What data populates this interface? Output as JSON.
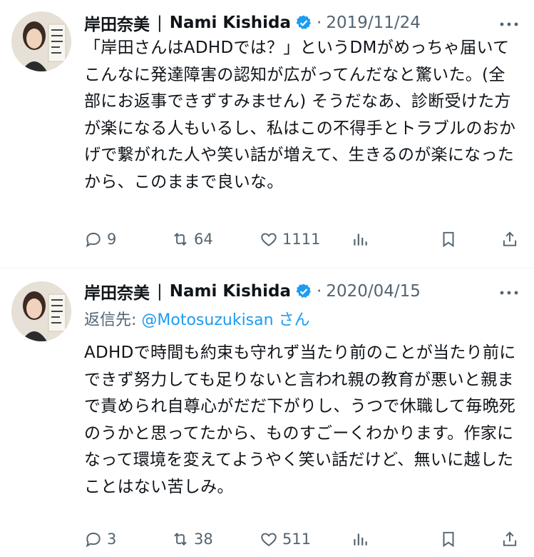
{
  "tweets": [
    {
      "display_name": "岸田奈美",
      "separator": "|",
      "handle_name": "Nami Kishida",
      "dot": "·",
      "date": "2019/11/24",
      "reply_prefix": "",
      "reply_handle": "",
      "reply_suffix": "",
      "text": "「岸田さんはADHDでは？」というDMがめっちゃ届いてこんなに発達障害の認知が広がってんだなと驚いた。(全部にお返事できずすみません) そうだなあ、診断受けた方が楽になる人もいるし、私はこの不得手とトラブルのおかげで繋がれた人や笑い話が増えて、生きるのが楽になったから、このままで良いな。",
      "replies": "9",
      "retweets": "64",
      "likes": "1111"
    },
    {
      "display_name": "岸田奈美",
      "separator": "|",
      "handle_name": "Nami Kishida",
      "dot": "·",
      "date": "2020/04/15",
      "reply_prefix": "返信先: ",
      "reply_handle": "@Motosuzukisan",
      "reply_suffix": " さん",
      "text": "ADHDで時間も約束も守れず当たり前のことが当たり前にできず努力しても足りないと言われ親の教育が悪いと親まで責められ自尊心がだだ下がりし、うつで休職して毎晩死のうかと思ってたから、ものすごーくわかります。作家になって環境を変えてようやく笑い話だけど、無いに越したことはない苦しみ。",
      "replies": "3",
      "retweets": "38",
      "likes": "511"
    }
  ],
  "icons": {
    "verified": "verified-badge-icon",
    "more": "more-icon",
    "reply": "reply-icon",
    "retweet": "retweet-icon",
    "like": "like-icon",
    "views": "views-icon",
    "bookmark": "bookmark-icon",
    "share": "share-icon"
  },
  "colors": {
    "text": "#0f1419",
    "secondary": "#536471",
    "link": "#1d9bf0",
    "verified": "#1d9bf0"
  }
}
